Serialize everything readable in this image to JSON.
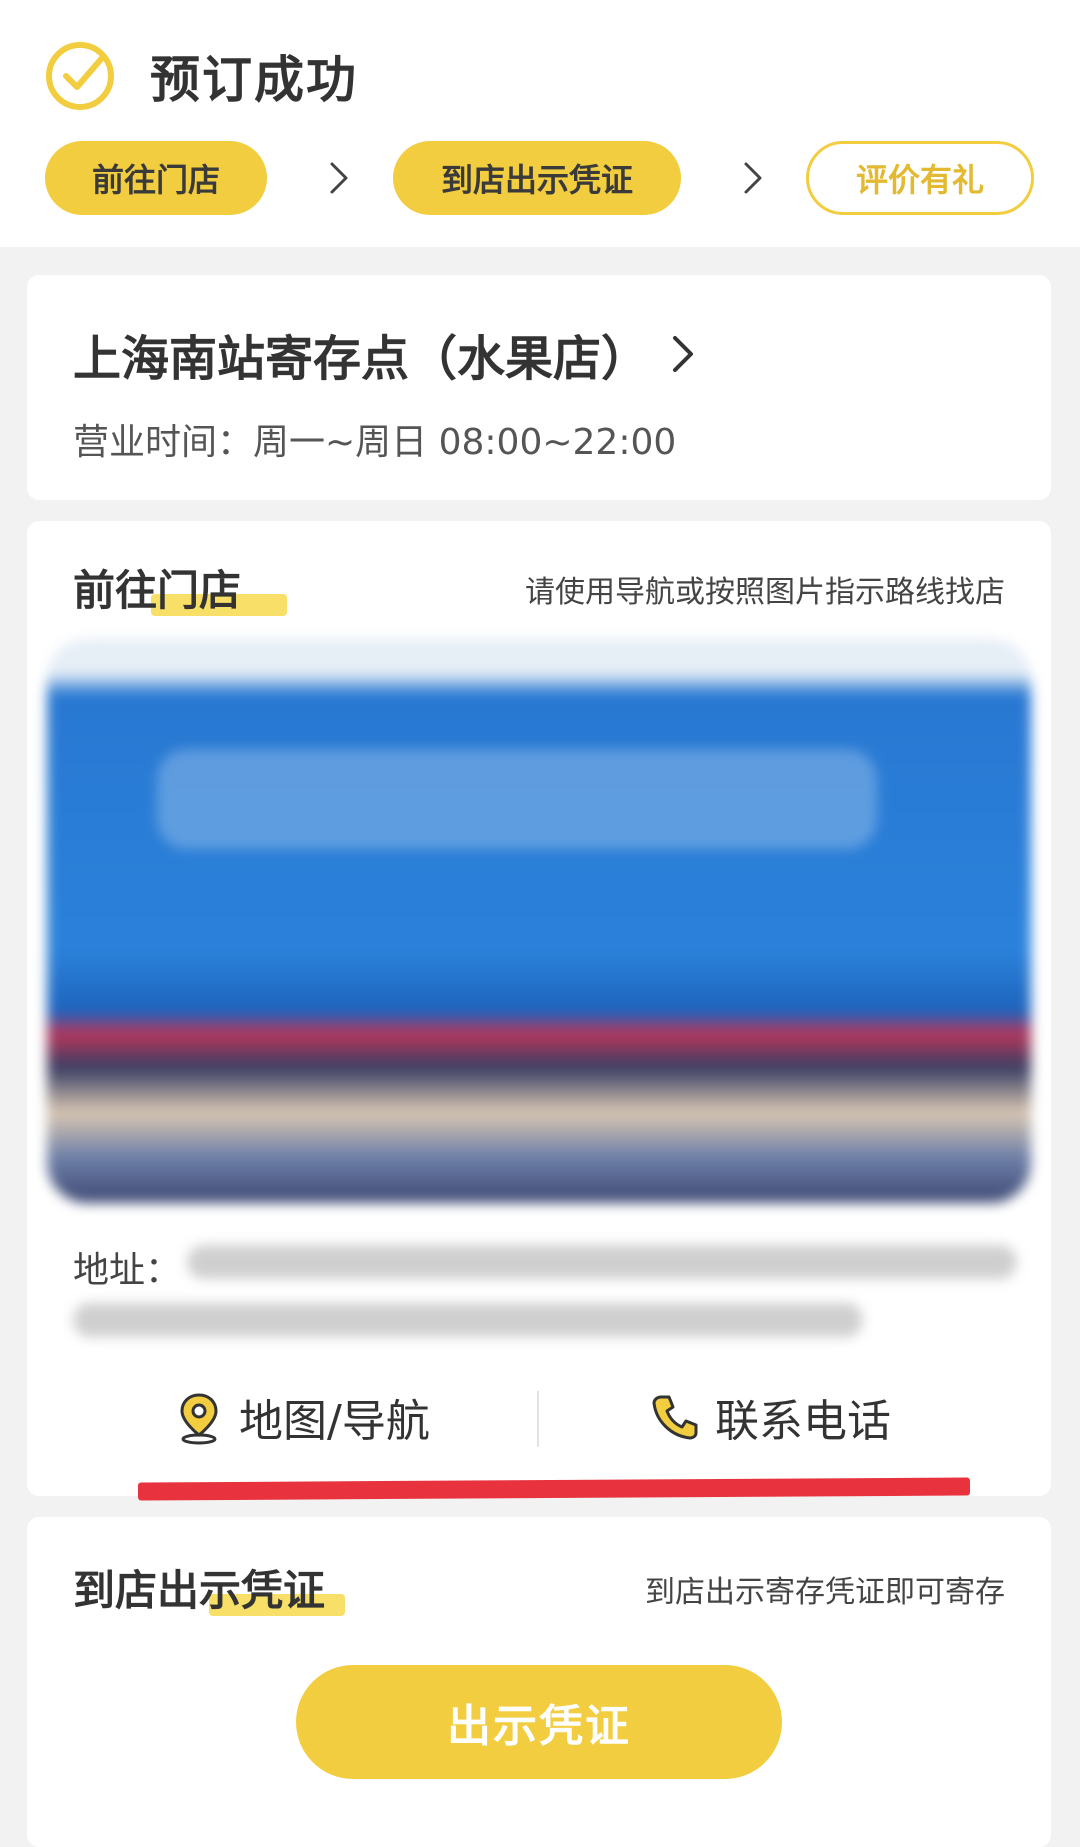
{
  "header": {
    "title": "预订成功",
    "steps": [
      {
        "label": "前往门店",
        "style": "filled"
      },
      {
        "label": "到店出示凭证",
        "style": "filled"
      },
      {
        "label": "评价有礼",
        "style": "outline"
      }
    ]
  },
  "store": {
    "name": "上海南站寄存点（水果店）",
    "hours": "营业时间：周一~周日 08:00~22:00"
  },
  "go_to_store": {
    "title": "前往门店",
    "hint": "请使用导航或按照图片指示路线找店",
    "address_label": "地址：",
    "actions": {
      "map": "地图/导航",
      "phone": "联系电话"
    }
  },
  "show_voucher": {
    "title": "到店出示凭证",
    "hint": "到店出示寄存凭证即可寄存",
    "button": "出示凭证"
  },
  "colors": {
    "accent": "#f2cd3f",
    "highlight": "#f8df68",
    "annotation_red": "#e8333f"
  }
}
